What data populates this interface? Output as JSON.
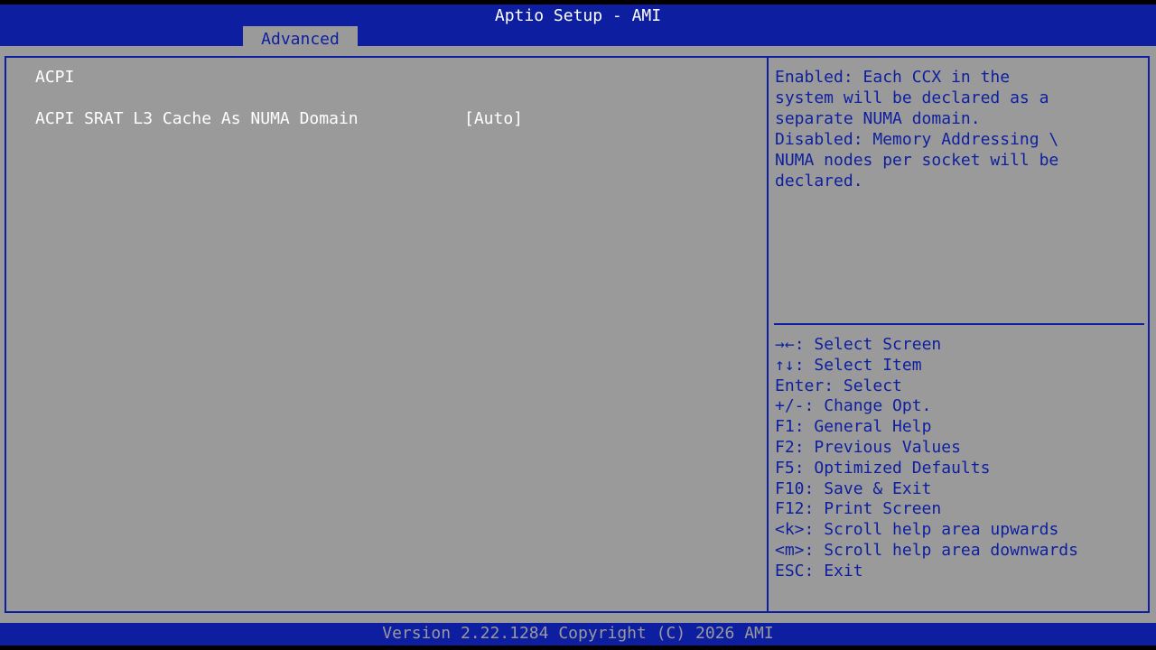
{
  "header": {
    "title": "Aptio Setup - AMI",
    "active_tab": "Advanced"
  },
  "main": {
    "section_title": "ACPI",
    "settings": [
      {
        "label": "ACPI SRAT L3 Cache As NUMA Domain",
        "value": "[Auto]"
      }
    ]
  },
  "help": {
    "lines": [
      "Enabled: Each CCX in the",
      "system will be declared as a",
      "separate NUMA domain.",
      "Disabled: Memory Addressing \\",
      "NUMA nodes per socket will be",
      "declared."
    ]
  },
  "keys": [
    {
      "key": "→←",
      "action": ": Select Screen"
    },
    {
      "key": "↑↓",
      "action": ": Select Item"
    },
    {
      "key": "Enter",
      "action": ": Select"
    },
    {
      "key": "+/-",
      "action": ": Change Opt."
    },
    {
      "key": "F1",
      "action": ": General Help"
    },
    {
      "key": "F2",
      "action": ": Previous Values"
    },
    {
      "key": "F5",
      "action": ": Optimized Defaults"
    },
    {
      "key": "F10",
      "action": ": Save & Exit"
    },
    {
      "key": "F12",
      "action": ": Print Screen"
    },
    {
      "key": "<k>",
      "action": ": Scroll help area upwards"
    },
    {
      "key": "<m>",
      "action": ": Scroll help area downwards"
    },
    {
      "key": "ESC",
      "action": ": Exit"
    }
  ],
  "footer": {
    "version": "Version 2.22.1284 Copyright (C) 2026 AMI"
  },
  "colors": {
    "bios_blue": "#0d1fa0",
    "bios_gray": "#9a9a9a",
    "text_white": "#ffffff"
  }
}
